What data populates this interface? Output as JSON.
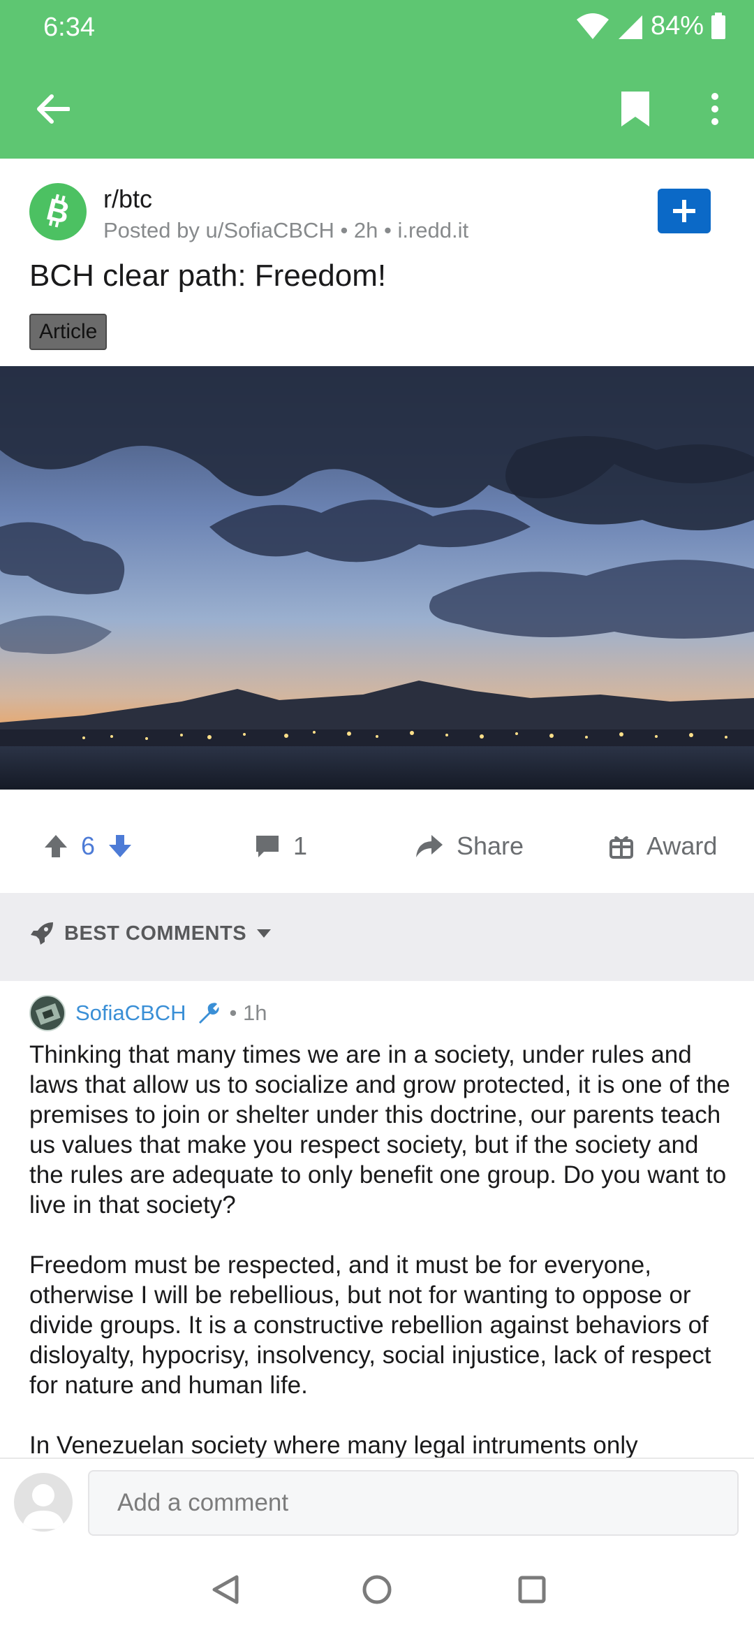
{
  "status_bar": {
    "time": "6:34",
    "battery": "84%"
  },
  "app_bar": {
    "back_icon": "arrow-left-icon",
    "bookmark_icon": "bookmark-icon",
    "more_icon": "more-vertical-icon"
  },
  "post": {
    "subreddit": "r/btc",
    "meta": "Posted by u/SofiaCBCH • 2h • i.redd.it",
    "title": "BCH clear path: Freedom!",
    "flair": "Article",
    "image_alt": "Sunset over a bay with city lights and clouds"
  },
  "actions": {
    "votes": "6",
    "comments": "1",
    "share": "Share",
    "award": "Award"
  },
  "sort": {
    "label": "BEST COMMENTS"
  },
  "comment": {
    "author": "SofiaCBCH",
    "time": "• 1h",
    "paragraphs": [
      "Thinking that many times we are in a society, under rules and laws that allow us to socialize and grow protected, it is one of the premises to join or shelter under this doctrine, our parents teach us values that make you respect society, but if the society and the rules are adequate to only benefit one group. Do you want to live in that society?",
      "Freedom must be respected, and it must be for everyone, otherwise I will be rebellious, but not for wanting to oppose or divide groups. It is a constructive rebellion against behaviors of disloyalty, hypocrisy, insolvency, social injustice, lack of respect for nature and human life.",
      "In Venezuelan society where many legal intruments only"
    ]
  },
  "add_comment": {
    "placeholder": "Add a comment"
  },
  "colors": {
    "app_bar": "#5ec672",
    "accent_blue": "#0b69c7",
    "vote": "#4d7bd6"
  }
}
